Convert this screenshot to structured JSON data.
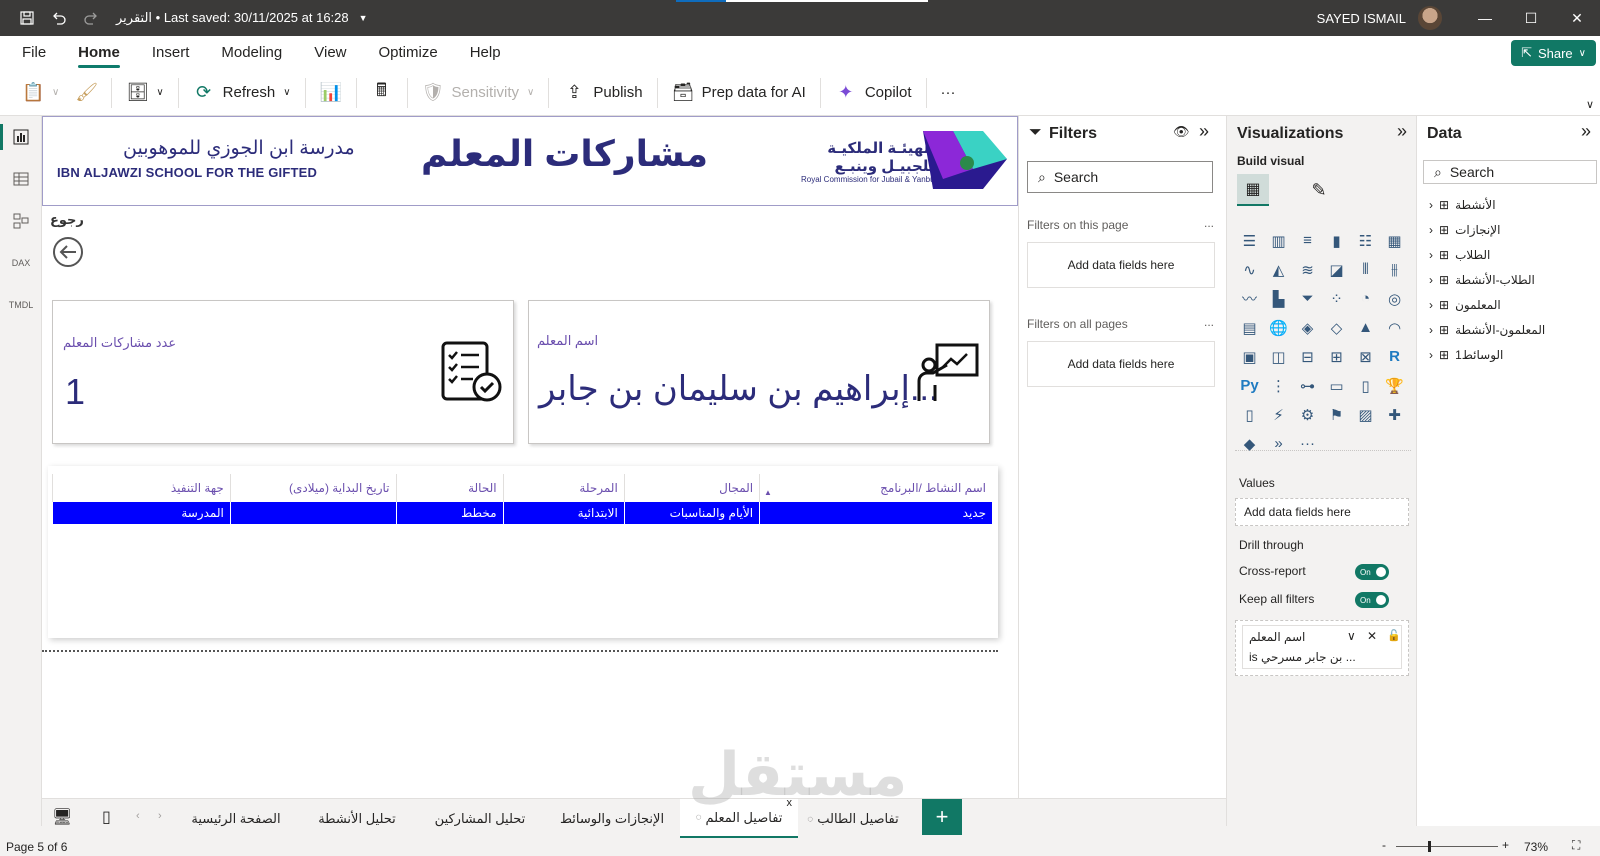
{
  "titlebar": {
    "doc_title": "التقرير • Last saved: 30/11/2025 at 16:28",
    "user": "SAYED ISMAIL"
  },
  "ribbon": {
    "tabs": [
      "File",
      "Home",
      "Insert",
      "Modeling",
      "View",
      "Optimize",
      "Help"
    ],
    "share": "Share",
    "toolbar": {
      "refresh": "Refresh",
      "sensitivity": "Sensitivity",
      "publish": "Publish",
      "prep": "Prep data for AI",
      "copilot": "Copilot",
      "more": "···"
    }
  },
  "left_rail": [
    "report-view",
    "table-view",
    "model-view",
    "dax-query-view",
    "tmdl-view"
  ],
  "report": {
    "school_ar": "مدرسة ابن الجوزي للموهوبين",
    "school_en": "IBN ALJAWZI SCHOOL FOR THE GIFTED",
    "title": "مشاركات المعلم",
    "rc_ar1": "الهيئـة الملكيـة",
    "rc_ar2": "للجبيـل وينبـع",
    "rc_en": "Royal Commission for Jubail & Yanbu",
    "back_label": "رجوع",
    "count_card": {
      "label": "عدد مشاركات المعلم",
      "value": "1"
    },
    "teacher_card": {
      "label": "اسم المعلم",
      "value": "...إبراهيم بن سليمان بن جابر"
    },
    "table": {
      "headers": [
        "اسم النشاط /البرنامج",
        "المجال",
        "المرحلة",
        "الحالة",
        "تاريخ البداية (ميلادى)",
        "جهة التنفيذ"
      ],
      "rows": [
        [
          "جديد",
          "الأيام والمناسبات",
          "الابتدائية",
          "مخطط",
          "",
          "المدرسة"
        ]
      ],
      "selected_color": "#0000ff"
    }
  },
  "filters": {
    "title": "Filters",
    "search": "Search",
    "on_page": "Filters on this page",
    "on_all": "Filters on all pages",
    "drop": "Add data fields here",
    "more": "..."
  },
  "visualizations": {
    "title": "Visualizations",
    "build": "Build visual",
    "values": "Values",
    "drop": "Add data fields here",
    "drill": "Drill through",
    "cross_report": "Cross-report",
    "keep_filters": "Keep all filters",
    "toggle_on": "On",
    "filter_field": "اسم المعلم",
    "filter_value": "is بن جابر مسرحي ..."
  },
  "data_pane": {
    "title": "Data",
    "search": "Search",
    "tables": [
      "الأنشطة",
      "الإنجازات",
      "الطلاب",
      "الطلاب-الأنشطة",
      "المعلمون",
      "المعلمون-الأنشطة",
      "الوسائط1"
    ]
  },
  "pages": {
    "tabs": [
      "الصفحة الرئيسية",
      "تحليل الأنشطة",
      "تحليل المشاركين",
      "الإنجازات والوسائط",
      "تفاصيل المعلم",
      "تفاصيل الطالب"
    ],
    "active": "تفاصيل المعلم",
    "add": "+",
    "close": "x"
  },
  "status": {
    "page": "Page 5 of 6",
    "zoom": "73%"
  },
  "watermark": "مستقل",
  "colors": {
    "accent": "#117865",
    "navy": "#2c2c7a",
    "purple": "#6b4fae"
  }
}
